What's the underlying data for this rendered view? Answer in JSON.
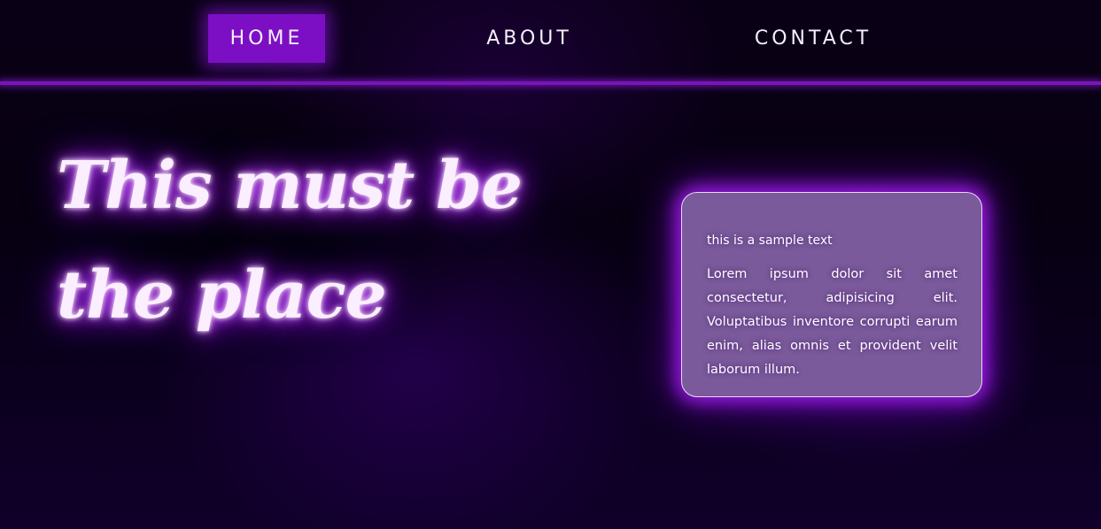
{
  "nav": {
    "items": [
      {
        "label": "HOME",
        "active": true
      },
      {
        "label": "ABOUT",
        "active": false
      },
      {
        "label": "CONTACT",
        "active": false
      }
    ]
  },
  "hero": {
    "title": "This must be the place"
  },
  "card": {
    "title": "this is a sample text",
    "body": "Lorem ipsum dolor sit amet consectetur, adipisicing elit. Voluptatibus inventore corrupti earum enim, alias omnis et provident velit laborum illum."
  },
  "colors": {
    "background": "#05000c",
    "accent_purple": "#7c0fc4",
    "nav_line": "#7a14b8",
    "card_background": "#7a5a9a",
    "glow": "#a51cff"
  }
}
